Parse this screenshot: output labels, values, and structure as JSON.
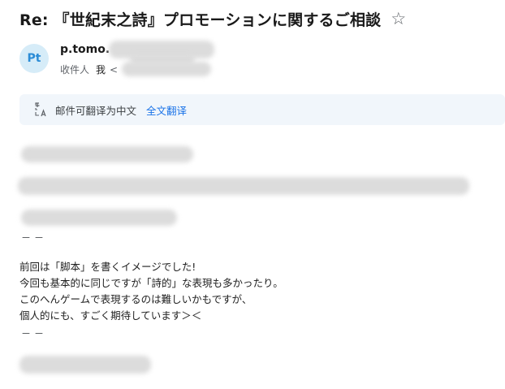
{
  "email": {
    "subject": "Re: 『世紀末之詩』プロモーションに関するご相談",
    "star_glyph": "☆",
    "sender": {
      "avatar_initials": "Pt",
      "name": "p.tomo.",
      "avatar_bg": "#d6ecf8",
      "avatar_fg": "#2b8cd6"
    },
    "recipient": {
      "label": "收件人",
      "me": "我",
      "open_bracket": "<"
    },
    "translate": {
      "icon": "translate-icon",
      "message": "邮件可翻译为中文",
      "link": "全文翻译",
      "link_color": "#1a73e8"
    },
    "body": {
      "separator_top": "－－",
      "lines": [
        "前回は「脚本」を書くイメージでした!",
        "今回も基本的に同じですが「詩的」な表現も多かったり。",
        "このへんゲームで表現するのは難しいかもですが、",
        "個人的にも、すごく期待しています＞＜"
      ],
      "separator_bottom": "－－"
    }
  }
}
